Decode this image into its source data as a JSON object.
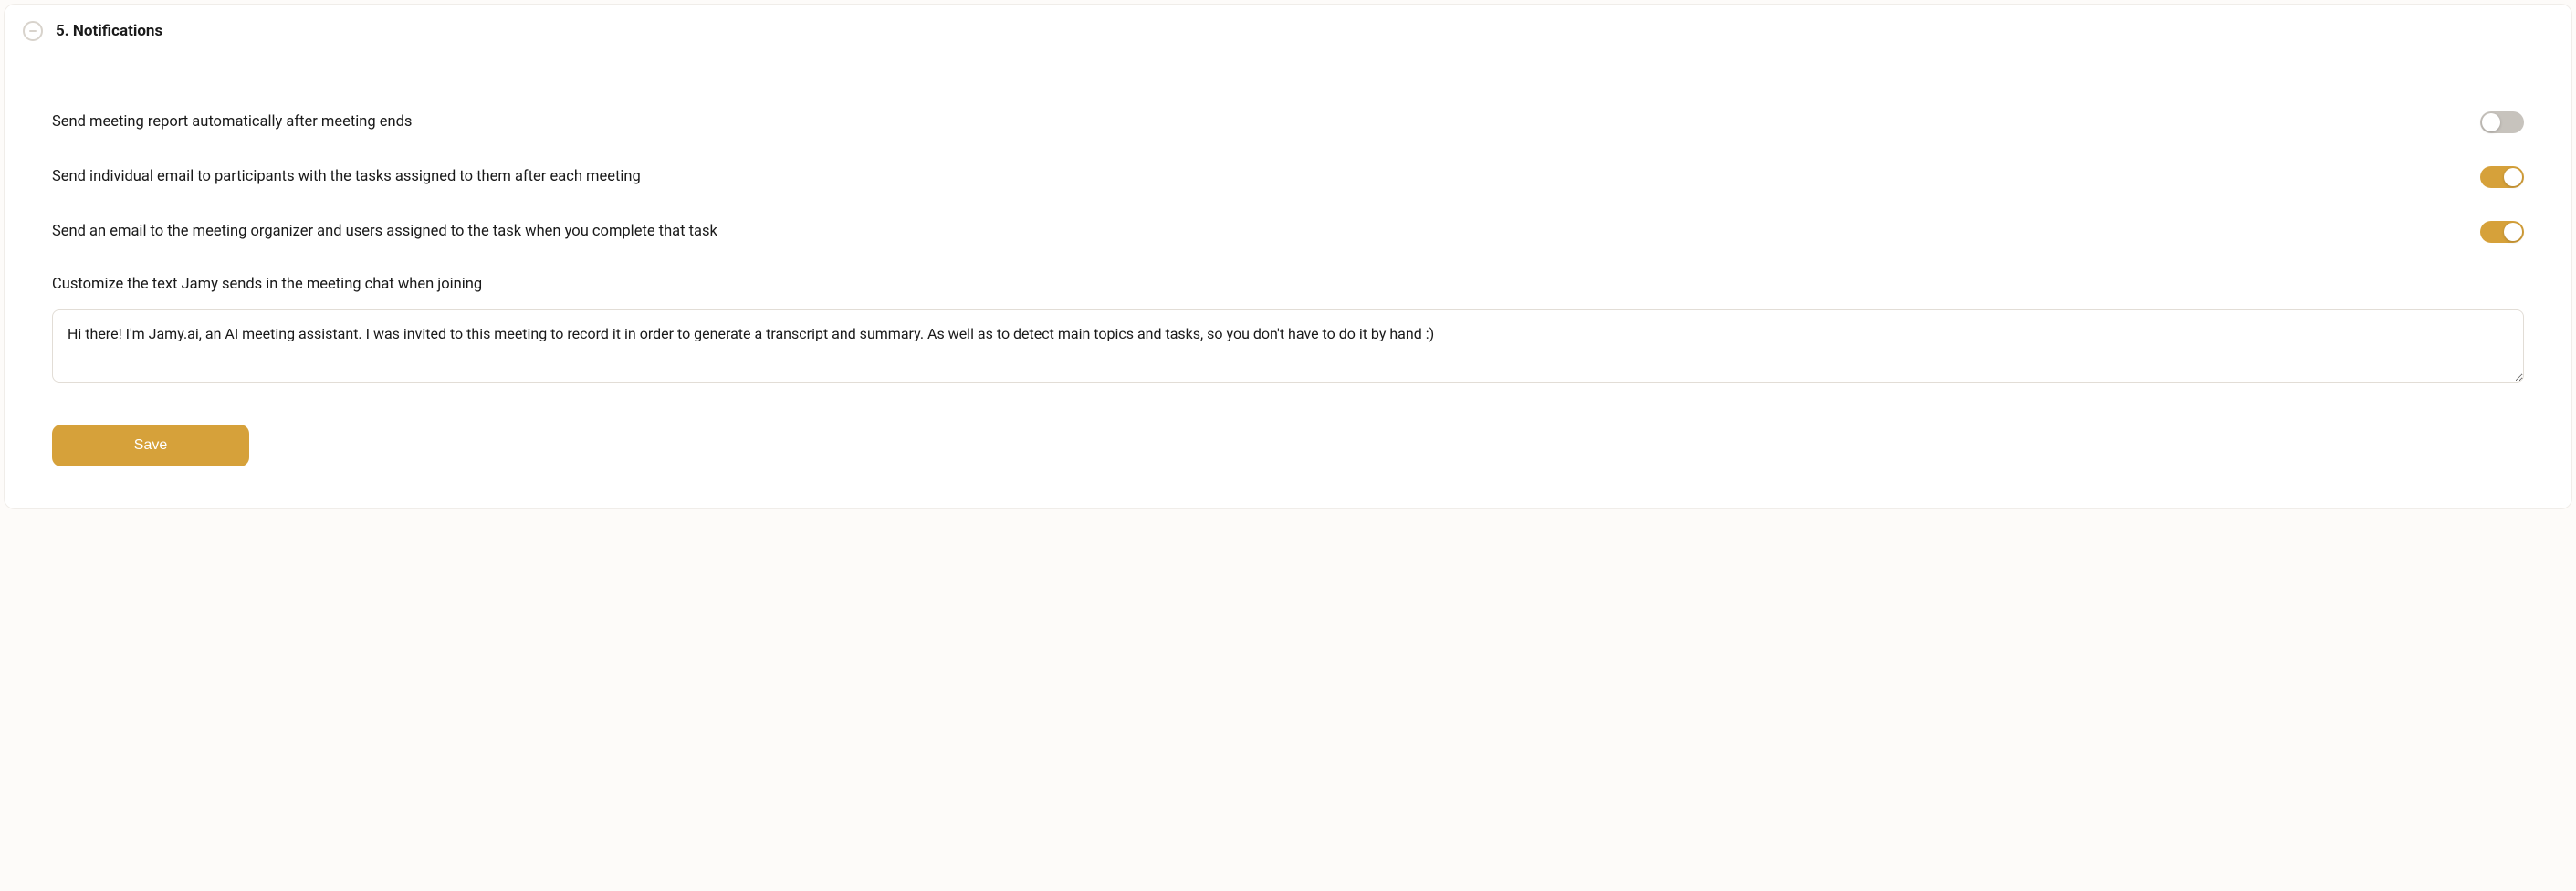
{
  "section": {
    "title": "5. Notifications"
  },
  "settings": {
    "auto_report": {
      "label": "Send meeting report automatically after meeting ends",
      "enabled": false
    },
    "task_email": {
      "label": "Send individual email to participants with the tasks assigned to them after each meeting",
      "enabled": true
    },
    "completion_email": {
      "label": "Send an email to the meeting organizer and users assigned to the task when you complete that task",
      "enabled": true
    },
    "customize": {
      "label": "Customize the text Jamy sends in the meeting chat when joining",
      "value": "Hi there! I'm Jamy.ai, an AI meeting assistant. I was invited to this meeting to record it in order to generate a transcript and summary. As well as to detect main topics and tasks, so you don't have to do it by hand :)"
    }
  },
  "actions": {
    "save": "Save"
  }
}
